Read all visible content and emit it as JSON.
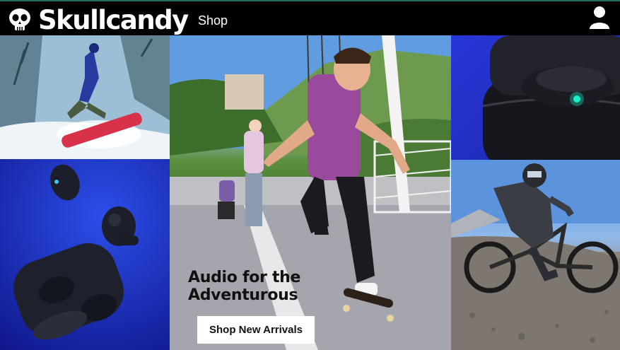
{
  "header": {
    "logo_text": "Skullcandy",
    "nav_shop": "Shop",
    "account_icon": "user-icon"
  },
  "hero": {
    "headline_line1": "Audio for the",
    "headline_line2": "Adventurous",
    "cta_label": "Shop New Arrivals"
  },
  "tiles": [
    {
      "name": "snowboarder-photo"
    },
    {
      "name": "earbuds-product-photo"
    },
    {
      "name": "skateboarder-photo"
    },
    {
      "name": "charging-case-photo"
    },
    {
      "name": "mountain-biker-photo"
    }
  ],
  "colors": {
    "brand_black": "#000000",
    "accent_blue": "#1f2fc0",
    "cta_background": "#ffffff"
  }
}
